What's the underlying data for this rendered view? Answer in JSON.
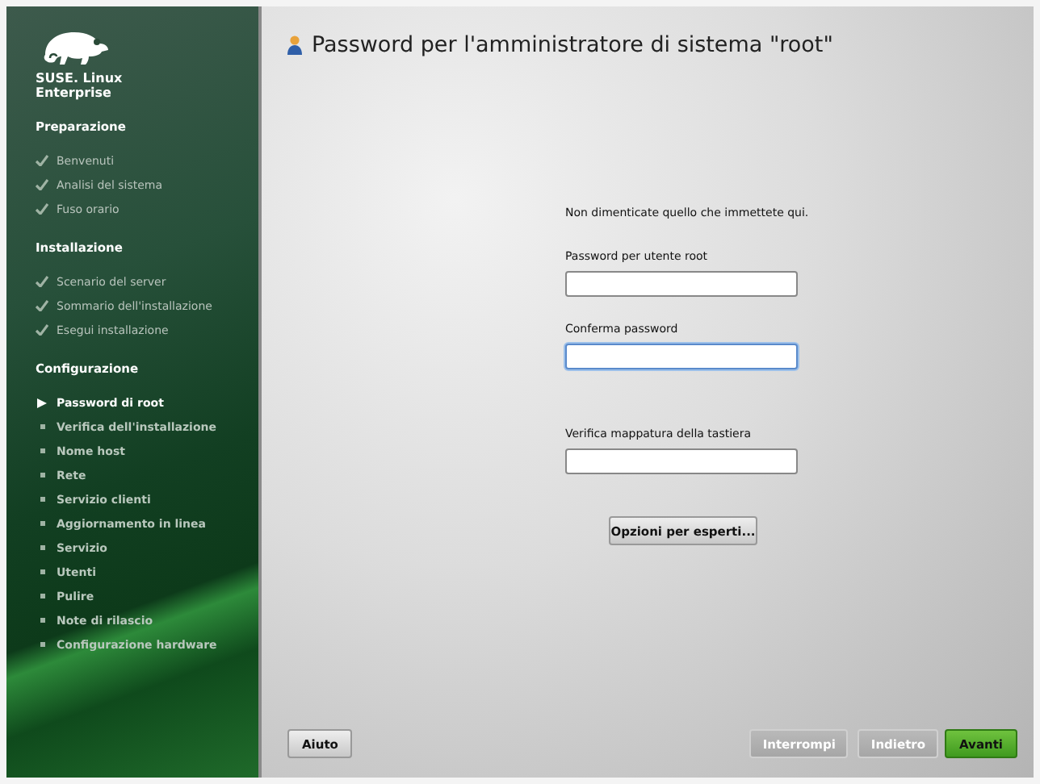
{
  "sidebar": {
    "brand": [
      "SUSE. Linux",
      "Enterprise"
    ],
    "sections": [
      {
        "title": "Preparazione",
        "steps": [
          {
            "label": "Benvenuti",
            "checked": true,
            "selected": false
          },
          {
            "label": "Analisi del sistema",
            "checked": true,
            "selected": false
          },
          {
            "label": "Fuso orario",
            "checked": true,
            "selected": false
          }
        ]
      },
      {
        "title": "Installazione",
        "steps": [
          {
            "label": "Scenario del server",
            "checked": true,
            "selected": false
          },
          {
            "label": "Sommario dell'installazione",
            "checked": true,
            "selected": false
          },
          {
            "label": "Esegui installazione",
            "checked": true,
            "selected": false
          }
        ]
      },
      {
        "title": "Configurazione",
        "steps": [
          {
            "label": "Password di root",
            "checked": false,
            "selected": true
          },
          {
            "label": "Verifica dell'installazione",
            "checked": false,
            "selected": false
          },
          {
            "label": "Nome host",
            "checked": false,
            "selected": false
          },
          {
            "label": "Rete",
            "checked": false,
            "selected": false
          },
          {
            "label": "Servizio clienti",
            "checked": false,
            "selected": false
          },
          {
            "label": "Aggiornamento in linea",
            "checked": false,
            "selected": false
          },
          {
            "label": "Servizio",
            "checked": false,
            "selected": false
          },
          {
            "label": "Utenti",
            "checked": false,
            "selected": false
          },
          {
            "label": "Pulire",
            "checked": false,
            "selected": false
          },
          {
            "label": "Note di rilascio",
            "checked": false,
            "selected": false
          },
          {
            "label": "Configurazione hardware",
            "checked": false,
            "selected": false
          }
        ]
      }
    ]
  },
  "page": {
    "title": "Password per l'amministratore di sistema \"root\"",
    "intro": "Non dimenticate quello che immettete qui.",
    "fields": [
      {
        "label": "Password per utente root",
        "focused": false
      },
      {
        "label": "Conferma password",
        "focused": true
      },
      {
        "label": "Verifica mappatura della tastiera",
        "focused": false
      }
    ],
    "expert_button": "Opzioni per esperti..."
  },
  "footer": {
    "help": "Aiuto",
    "buttons": [
      {
        "label": "Interrompi",
        "kind": "secondary"
      },
      {
        "label": "Indietro",
        "kind": "secondary"
      },
      {
        "label": "Avanti",
        "kind": "primary"
      }
    ]
  }
}
